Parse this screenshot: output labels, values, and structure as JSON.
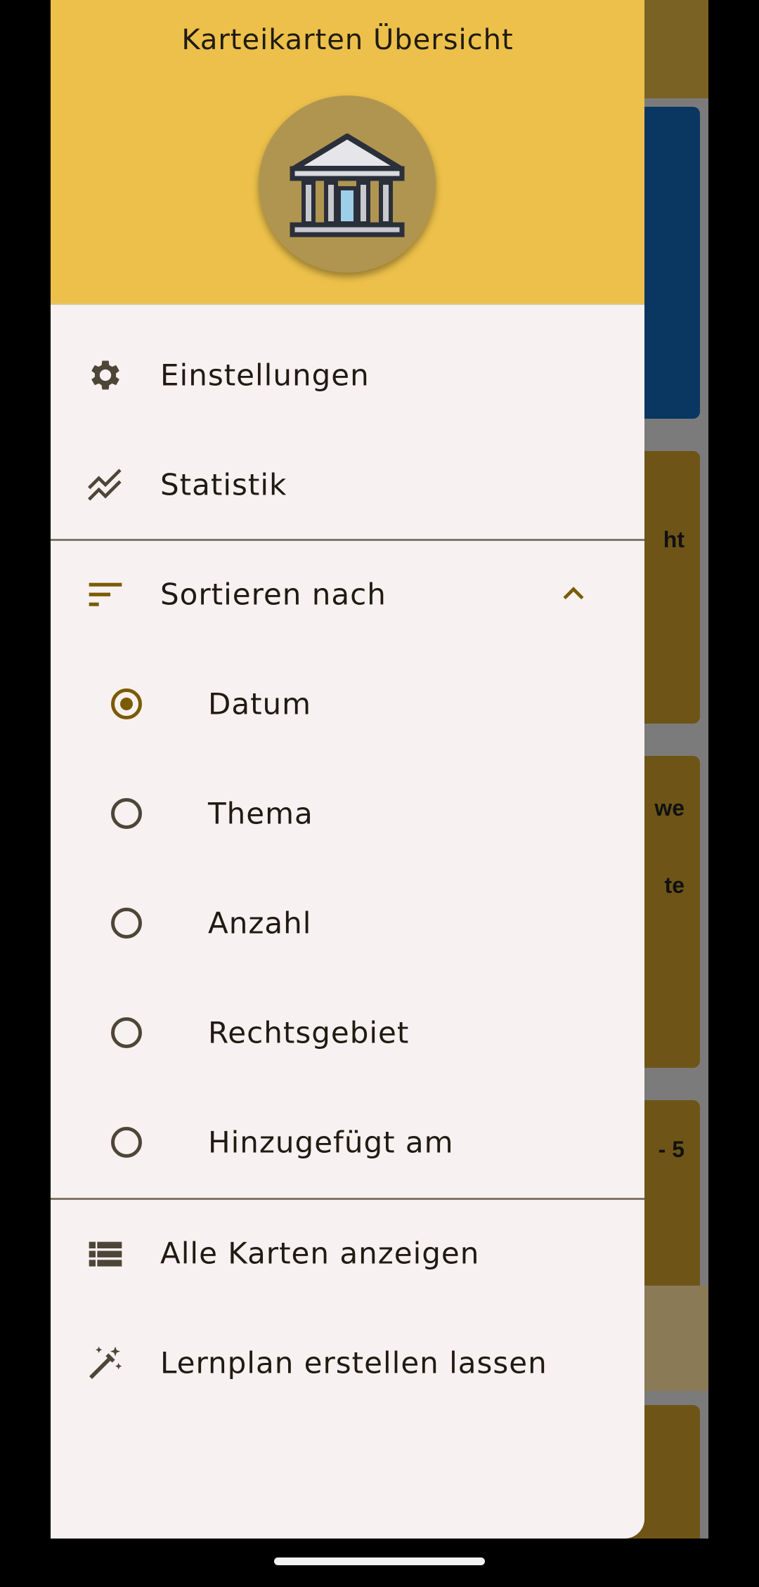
{
  "background": {
    "card_texts": [
      "ht",
      "we",
      "te",
      "- 5"
    ]
  },
  "drawer": {
    "title": "Karteikarten Übersicht",
    "avatar_icon": "courthouse-icon",
    "menu": {
      "settings_label": "Einstellungen",
      "statistics_label": "Statistik"
    },
    "sort": {
      "label": "Sortieren nach",
      "expanded": true,
      "options": [
        {
          "label": "Datum",
          "selected": true
        },
        {
          "label": "Thema",
          "selected": false
        },
        {
          "label": "Anzahl",
          "selected": false
        },
        {
          "label": "Rechtsgebiet",
          "selected": false
        },
        {
          "label": "Hinzugefügt am",
          "selected": false
        }
      ]
    },
    "actions": {
      "show_all_label": "Alle Karten anzeigen",
      "study_plan_label": "Lernplan erstellen lassen"
    }
  },
  "colors": {
    "header": "#ecc04a",
    "accent": "#7a5b00",
    "drawer_bg": "#f8f1f1"
  }
}
